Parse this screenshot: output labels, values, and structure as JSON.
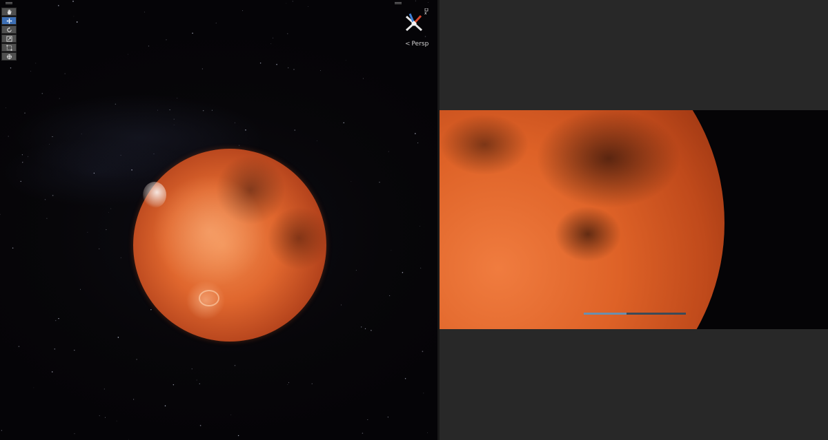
{
  "scene_view": {
    "tools": [
      {
        "name": "hand-tool",
        "icon": "hand-icon",
        "active": false
      },
      {
        "name": "move-tool",
        "icon": "move-arrows-icon",
        "active": true
      },
      {
        "name": "rotate-tool",
        "icon": "rotate-icon",
        "active": false
      },
      {
        "name": "scale-tool",
        "icon": "scale-icon",
        "active": false
      },
      {
        "name": "rect-tool",
        "icon": "rect-transform-icon",
        "active": false
      },
      {
        "name": "transform-tool",
        "icon": "transform-icon",
        "active": false
      }
    ],
    "camera_mode": "Persp",
    "gizmo": {
      "axis_colors": {
        "x": "#d8462c",
        "y": "#e8e8e8",
        "z": "#3d7fd6"
      },
      "icon": "orientation-gizmo-icon"
    },
    "background_color": "#07060a",
    "planet": {
      "name": "Mars",
      "accent_color": "#e0672e"
    }
  },
  "game_view": {
    "background_color": "#282828",
    "progress": 0.42,
    "progress_colors": {
      "track": "#3b4a58",
      "fill": "#6b8fae"
    }
  }
}
